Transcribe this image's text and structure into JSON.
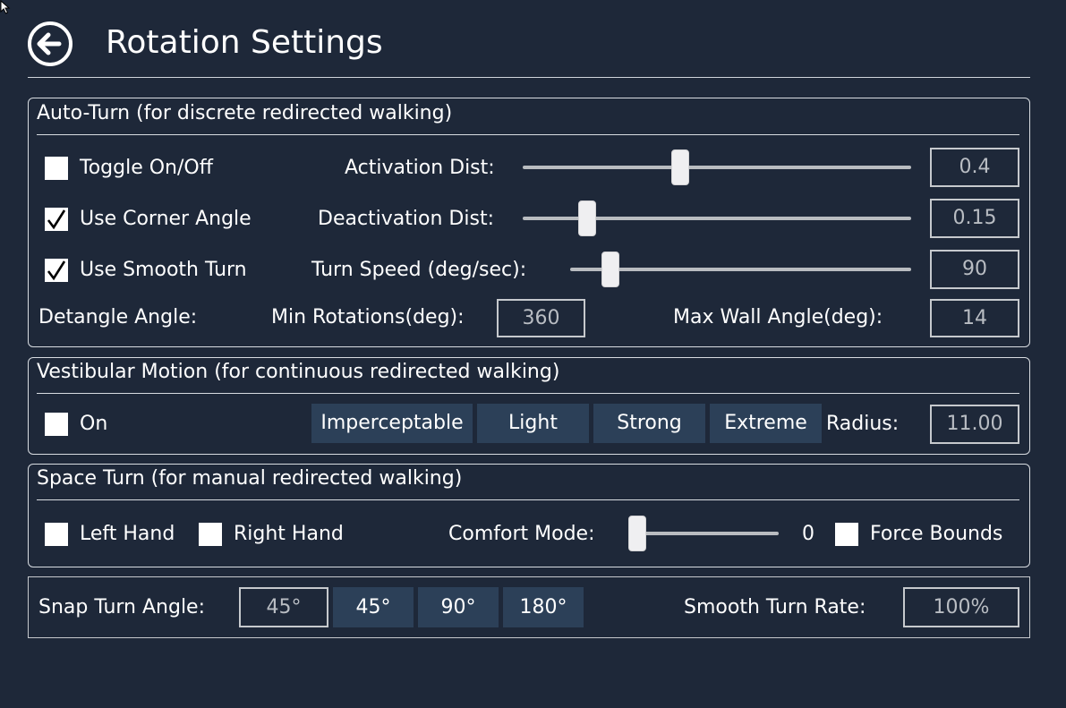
{
  "header": {
    "title": "Rotation Settings",
    "back_icon": "arrow-left-circle-icon"
  },
  "colors": {
    "background": "#1e2839",
    "button_fill": "#2c4058",
    "border": "#d8dce1",
    "value_text": "#b9bdc3"
  },
  "auto_turn": {
    "title": "Auto-Turn (for discrete redirected walking)",
    "toggle": {
      "label": "Toggle On/Off",
      "checked": false
    },
    "use_corner_angle": {
      "label": "Use Corner Angle",
      "checked": true
    },
    "use_smooth_turn": {
      "label": "Use Smooth Turn",
      "checked": true
    },
    "activation_dist": {
      "label": "Activation Dist:",
      "value": "0.4",
      "slider_fraction": 0.4
    },
    "deactivation_dist": {
      "label": "Deactivation Dist:",
      "value": "0.15",
      "slider_fraction": 0.15
    },
    "turn_speed": {
      "label": "Turn Speed (deg/sec):",
      "value": "90",
      "slider_fraction": 0.12
    },
    "detangle_label": "Detangle Angle:",
    "min_rotations": {
      "label": "Min Rotations(deg):",
      "value": "360"
    },
    "max_wall_angle": {
      "label": "Max Wall Angle(deg):",
      "value": "14"
    }
  },
  "vestibular": {
    "title": "Vestibular Motion (for continuous redirected walking)",
    "on": {
      "label": "On",
      "checked": false
    },
    "presets": [
      "Imperceptable",
      "Light",
      "Strong",
      "Extreme"
    ],
    "radius": {
      "label": "Radius:",
      "value": "11.00"
    }
  },
  "space_turn": {
    "title": "Space Turn (for manual redirected walking)",
    "left_hand": {
      "label": "Left Hand",
      "checked": false
    },
    "right_hand": {
      "label": "Right Hand",
      "checked": false
    },
    "comfort_mode": {
      "label": "Comfort Mode:",
      "value": "0",
      "slider_fraction": 0.0
    },
    "force_bounds": {
      "label": "Force Bounds",
      "checked": false
    }
  },
  "snap": {
    "label": "Snap Turn Angle:",
    "value": "45°",
    "options": [
      "45°",
      "90°",
      "180°"
    ],
    "smooth_rate": {
      "label": "Smooth Turn Rate:",
      "value": "100%"
    }
  }
}
